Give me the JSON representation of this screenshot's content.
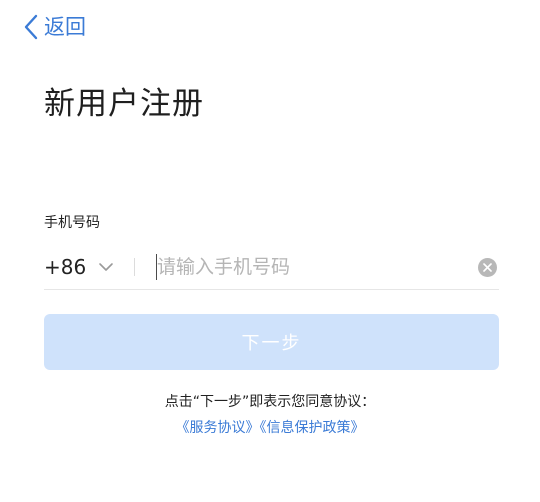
{
  "nav": {
    "back_label": "返回",
    "back_icon": "chevron-left-icon"
  },
  "title": "新用户注册",
  "phone": {
    "label": "手机号码",
    "country_code": "+86",
    "placeholder": "请输入手机号码",
    "value": "",
    "clear_icon": "clear-circle-icon"
  },
  "next_button_label": "下一步",
  "agreement": {
    "text": "点击“下一步”即表示您同意协议：",
    "links": [
      "《服务协议》",
      "《信息保护政策》"
    ]
  },
  "colors": {
    "accent": "#3b7bd6",
    "button_disabled_bg": "#cfe2fb",
    "placeholder": "#b5b5b5"
  }
}
